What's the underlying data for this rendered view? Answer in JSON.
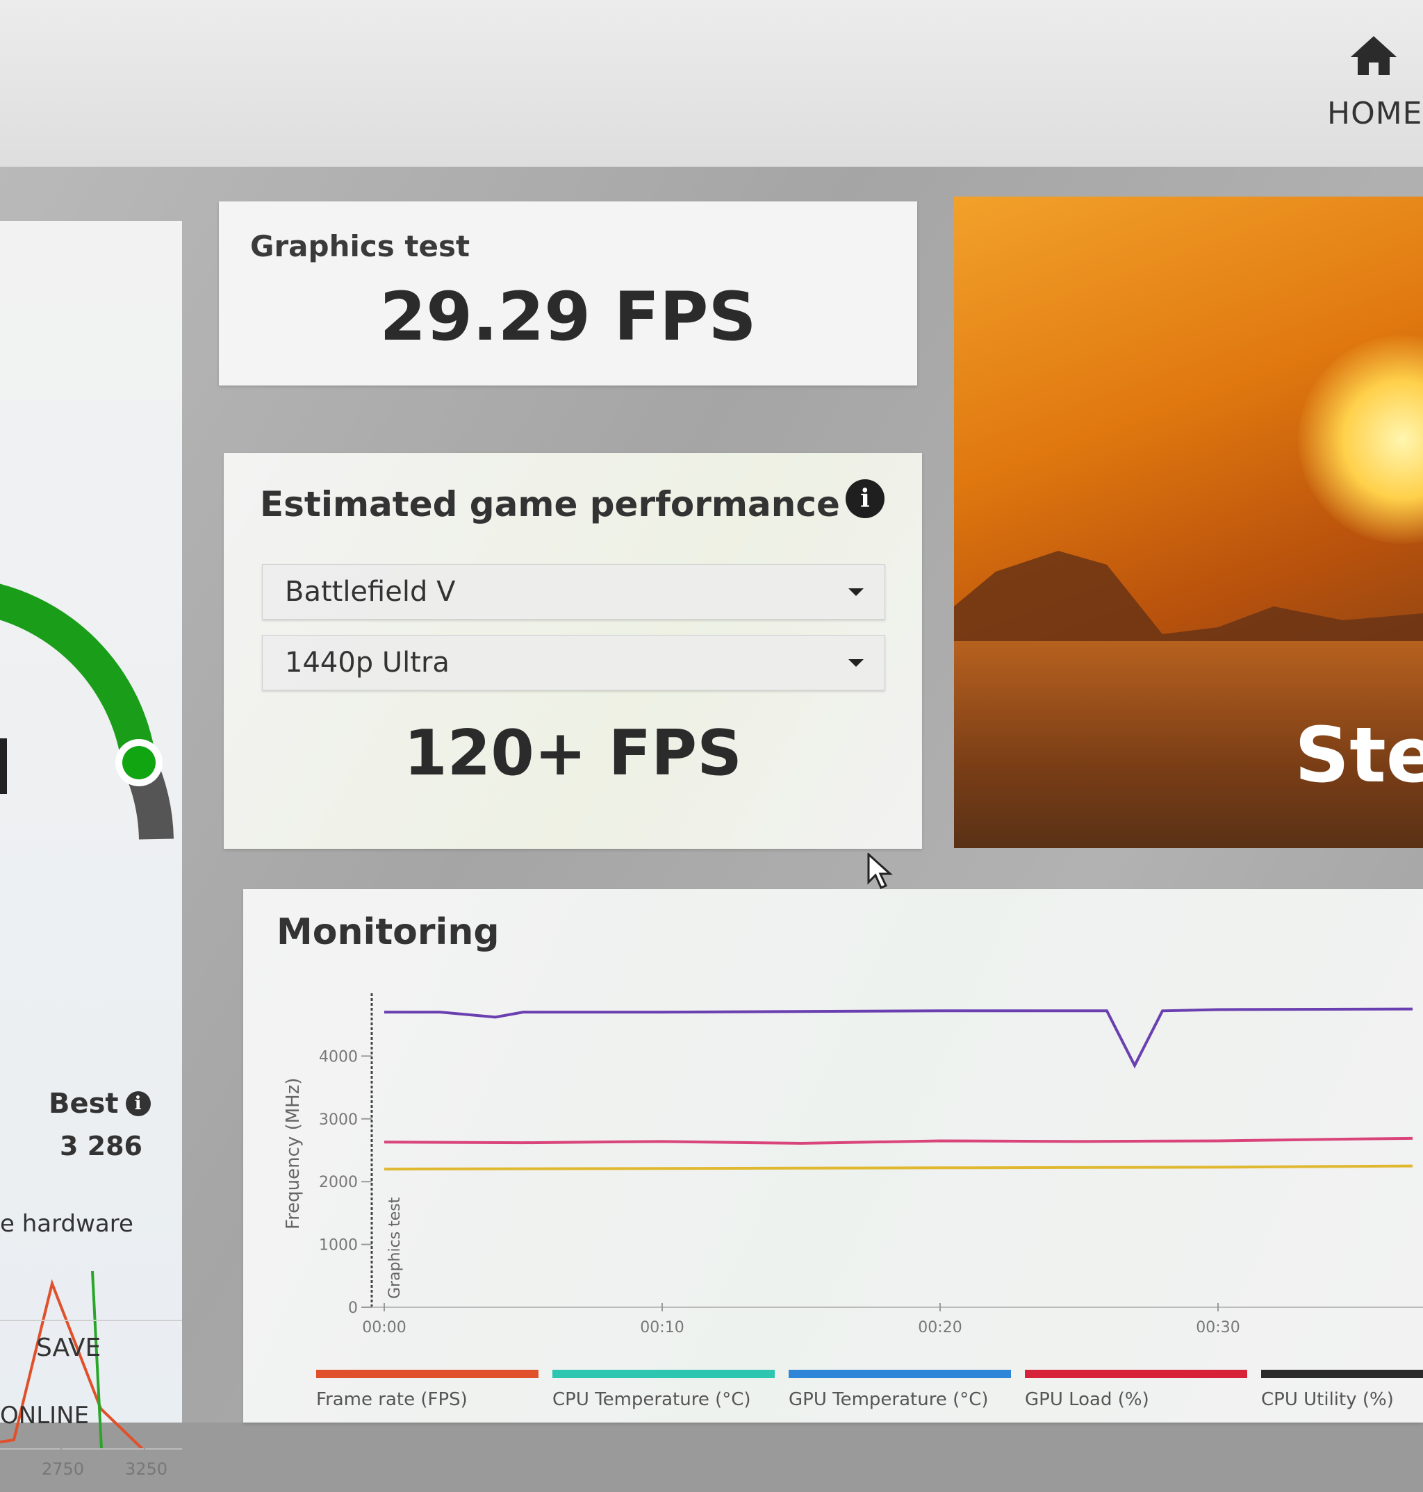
{
  "header": {
    "home_label": "HOME"
  },
  "score_panel": {
    "best_label": "Best",
    "best_value": "3 286",
    "hardware_text": "e hardware",
    "distribution_ticks": [
      "2750",
      "3250"
    ],
    "save_label": "SAVE",
    "online_label": "ONLINE",
    "gauge_color": "#1a9e1a"
  },
  "graphics_test": {
    "title": "Graphics test",
    "value": "29.29 FPS"
  },
  "estimated_game_performance": {
    "title": "Estimated game performance",
    "info_icon": "info-icon",
    "game_select": "Battlefield V",
    "preset_select": "1440p Ultra",
    "value": "120+ FPS"
  },
  "game_banner": {
    "title": "Stee"
  },
  "monitoring": {
    "title": "Monitoring",
    "chart_data": {
      "type": "line",
      "ylabel": "Frequency (MHz)",
      "yticks": [
        "4000",
        "3000",
        "2000",
        "1000",
        "0"
      ],
      "xticks": [
        "00:00",
        "00:10",
        "00:20",
        "00:30"
      ],
      "marker_label": "Graphics test",
      "ylim": [
        0,
        4500
      ],
      "series": [
        {
          "color": "#6a3fb0",
          "x": [
            0,
            2,
            4,
            5,
            10,
            20,
            26,
            27,
            28,
            30,
            37
          ],
          "y": [
            4700,
            4700,
            4620,
            4700,
            4700,
            4720,
            4720,
            3850,
            4720,
            4740,
            4750
          ]
        },
        {
          "color": "#d9457a",
          "x": [
            0,
            5,
            10,
            15,
            20,
            25,
            30,
            35,
            37
          ],
          "y": [
            2630,
            2620,
            2640,
            2610,
            2650,
            2640,
            2650,
            2680,
            2690
          ]
        },
        {
          "color": "#e0b830",
          "x": [
            0,
            10,
            20,
            30,
            37
          ],
          "y": [
            2200,
            2210,
            2220,
            2230,
            2250
          ]
        }
      ]
    },
    "legend": [
      {
        "label": "Frame rate (FPS)",
        "color": "#e0502a"
      },
      {
        "label": "CPU Temperature (°C)",
        "color": "#2dc6b0"
      },
      {
        "label": "GPU Temperature (°C)",
        "color": "#2f86d8"
      },
      {
        "label": "GPU Load (%)",
        "color": "#d8223a"
      },
      {
        "label": "CPU Utility (%)",
        "color": "#2b2b2b"
      }
    ]
  }
}
